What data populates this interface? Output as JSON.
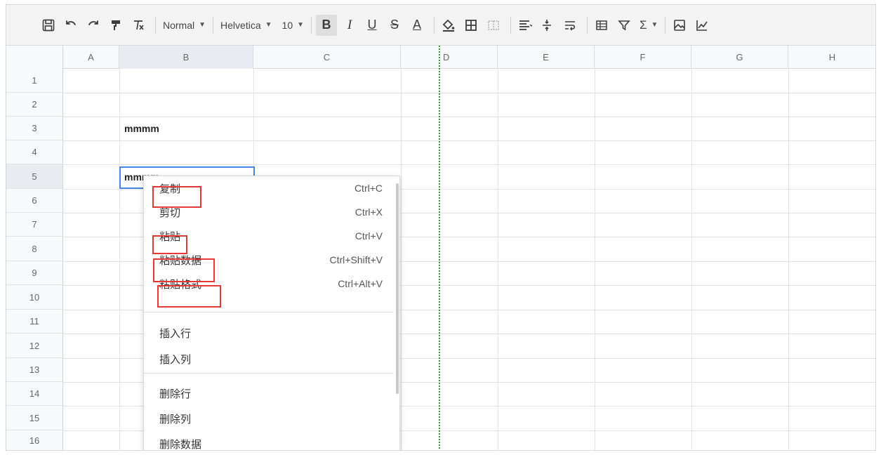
{
  "toolbar": {
    "style_select": "Normal",
    "font_select": "Helvetica",
    "size_select": "10",
    "bold_label": "B",
    "italic_label": "I",
    "underline_label": "U",
    "strike_label": "S",
    "textcolor_label": "A",
    "sum_label": "Σ"
  },
  "columns": [
    "A",
    "B",
    "C",
    "D",
    "E",
    "F",
    "G",
    "H"
  ],
  "rows": [
    "1",
    "2",
    "3",
    "4",
    "5",
    "6",
    "7",
    "8",
    "9",
    "10",
    "11",
    "12",
    "13",
    "14",
    "15",
    "16"
  ],
  "cells": {
    "b3": "mmmm",
    "b5": "mmmm"
  },
  "context_menu": {
    "copy": {
      "label": "复制",
      "shortcut": "Ctrl+C"
    },
    "cut": {
      "label": "剪切",
      "shortcut": "Ctrl+X"
    },
    "paste": {
      "label": "粘贴",
      "shortcut": "Ctrl+V"
    },
    "paste_data": {
      "label": "粘贴数据",
      "shortcut": "Ctrl+Shift+V"
    },
    "paste_format": {
      "label": "粘贴格式",
      "shortcut": "Ctrl+Alt+V"
    },
    "insert_row": {
      "label": "插入行"
    },
    "insert_col": {
      "label": "插入列"
    },
    "delete_row": {
      "label": "删除行"
    },
    "delete_col": {
      "label": "删除列"
    },
    "delete_data": {
      "label": "删除数据"
    }
  },
  "colors": {
    "selection": "#4a86e8",
    "highlight": "#e53935",
    "dashed_border": "#2aa02a"
  }
}
